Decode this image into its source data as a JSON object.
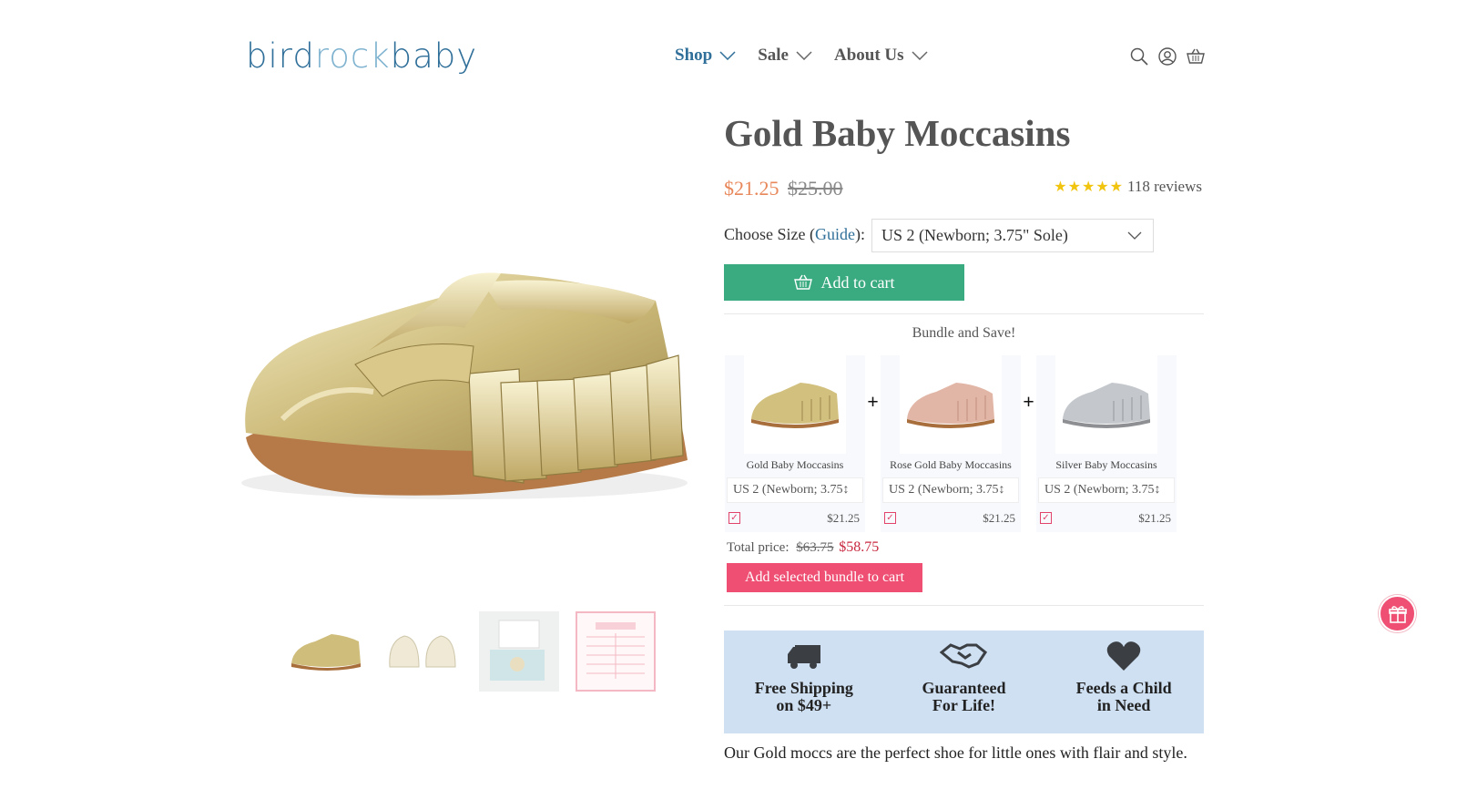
{
  "header": {
    "logo": {
      "part1": "bird",
      "part2": "rock",
      "part3": "baby"
    },
    "nav": [
      {
        "label": "Shop",
        "active": true
      },
      {
        "label": "Sale",
        "active": false
      },
      {
        "label": "About Us",
        "active": false
      }
    ],
    "icons": [
      "search-icon",
      "account-icon",
      "cart-icon"
    ]
  },
  "product": {
    "title": "Gold Baby Moccasins",
    "price_sale": "$21.25",
    "price_original": "$25.00",
    "stars": "★★★★★",
    "reviews": "118 reviews",
    "size_label_prefix": "Choose Size (",
    "size_guide": "Guide",
    "size_label_suffix": "):",
    "size_selected": "US 2 (Newborn; 3.75\" Sole)",
    "add_to_cart": "Add to cart",
    "description": "Our Gold moccs are the perfect shoe for little ones with flair and style."
  },
  "thumbnails": [
    "gold-moccasin-side",
    "cream-moccasin-pair",
    "gift-box-photo",
    "size-chart-card"
  ],
  "bundle": {
    "title": "Bundle and Save!",
    "items": [
      {
        "name": "Gold Baby Moccasins",
        "size": "US 2 (Newborn; 3.75↕",
        "price": "$21.25",
        "checked": "✓"
      },
      {
        "name": "Rose Gold Baby Moccasins",
        "size": "US 2 (Newborn; 3.75↕",
        "price": "$21.25",
        "checked": "✓"
      },
      {
        "name": "Silver Baby Moccasins",
        "size": "US 2 (Newborn; 3.75↕",
        "price": "$21.25",
        "checked": "✓"
      }
    ],
    "plus": "+",
    "total_label": "Total price:",
    "total_old": "$63.75",
    "total_new": "$58.75",
    "button": "Add selected bundle to cart"
  },
  "features": [
    {
      "line1": "Free Shipping",
      "line2": "on $49+",
      "icon": "truck-icon"
    },
    {
      "line1": "Guaranteed",
      "line2": "For Life!",
      "icon": "handshake-icon"
    },
    {
      "line1": "Feeds a Child",
      "line2": "in Need",
      "icon": "heart-icon"
    }
  ],
  "colors": {
    "brand": "#2f6f99",
    "sale": "#e8875a",
    "cart_button": "#3aaa80",
    "bundle_button": "#ee4f73",
    "features_bg": "#cfe0f3"
  }
}
